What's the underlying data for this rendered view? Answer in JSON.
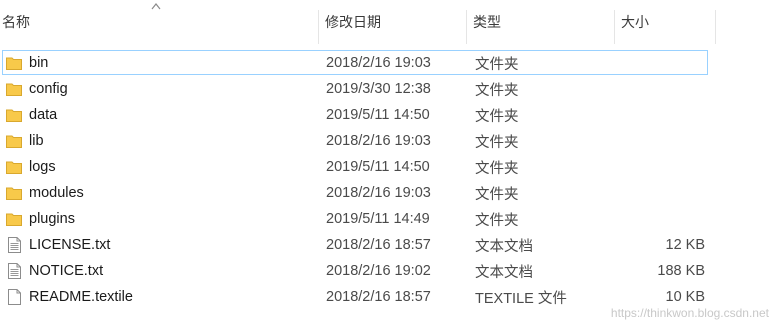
{
  "columns": {
    "name": "名称",
    "date": "修改日期",
    "type": "类型",
    "size": "大小"
  },
  "rows": [
    {
      "name": "bin",
      "date": "2018/2/16 19:03",
      "type": "文件夹",
      "size": "",
      "icon": "folder-icon"
    },
    {
      "name": "config",
      "date": "2019/3/30 12:38",
      "type": "文件夹",
      "size": "",
      "icon": "folder-icon"
    },
    {
      "name": "data",
      "date": "2019/5/11 14:50",
      "type": "文件夹",
      "size": "",
      "icon": "folder-icon"
    },
    {
      "name": "lib",
      "date": "2018/2/16 19:03",
      "type": "文件夹",
      "size": "",
      "icon": "folder-icon"
    },
    {
      "name": "logs",
      "date": "2019/5/11 14:50",
      "type": "文件夹",
      "size": "",
      "icon": "folder-icon"
    },
    {
      "name": "modules",
      "date": "2018/2/16 19:03",
      "type": "文件夹",
      "size": "",
      "icon": "folder-icon"
    },
    {
      "name": "plugins",
      "date": "2019/5/11 14:49",
      "type": "文件夹",
      "size": "",
      "icon": "folder-icon"
    },
    {
      "name": "LICENSE.txt",
      "date": "2018/2/16 18:57",
      "type": "文本文档",
      "size": "12 KB",
      "icon": "text-file-icon"
    },
    {
      "name": "NOTICE.txt",
      "date": "2018/2/16 19:02",
      "type": "文本文档",
      "size": "188 KB",
      "icon": "text-file-icon"
    },
    {
      "name": "README.textile",
      "date": "2018/2/16 18:57",
      "type": "TEXTILE 文件",
      "size": "10 KB",
      "icon": "blank-file-icon"
    }
  ],
  "watermark": "https://thinkwon.blog.csdn.net",
  "colors": {
    "folder": "#f8c94a",
    "selection_border": "#99d1ff"
  }
}
